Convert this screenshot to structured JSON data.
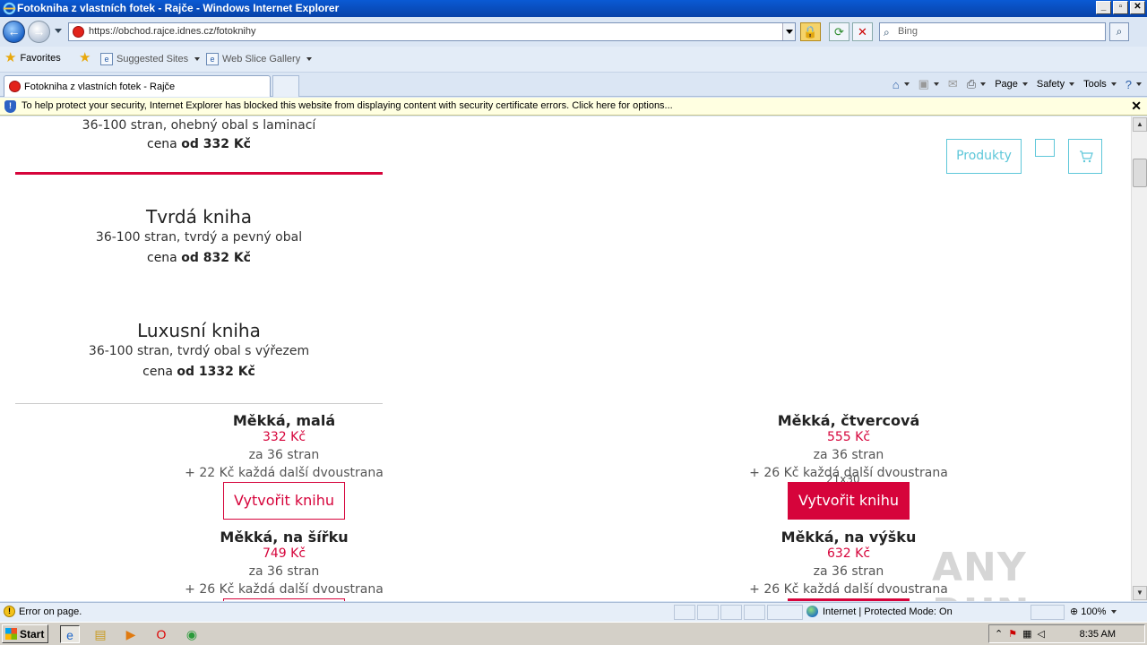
{
  "window": {
    "title": "Fotokniha z vlastních fotek - Rajče - Windows Internet Explorer",
    "min_label": "_",
    "max_label": "▫",
    "close_label": "✕"
  },
  "addressbar": {
    "back_icon": "back-arrow-icon",
    "forward_icon": "forward-arrow-icon",
    "url": "https://obchod.rajce.idnes.cz/fotoknihy",
    "search_placeholder": "Bing"
  },
  "favorites": {
    "favorites_label": "Favorites",
    "suggested_sites": "Suggested Sites",
    "web_slice_gallery": "Web Slice Gallery"
  },
  "tab": {
    "label": "Fotokniha z vlastních fotek - Rajče"
  },
  "commandbar": {
    "page": "Page",
    "safety": "Safety",
    "tools": "Tools"
  },
  "infobar": {
    "message": "To help protect your security, Internet Explorer has blocked this website from displaying content with security certificate errors. Click here for options..."
  },
  "page": {
    "top_product": {
      "desc": "36-100 stran, ohebný obal s laminací",
      "price_prefix": "cena",
      "price": "od 332 Kč"
    },
    "products": [
      {
        "name": "Tvrdá kniha",
        "desc": "36-100 stran, tvrdý a pevný obal",
        "price_prefix": "cena",
        "price": "od 832 Kč"
      },
      {
        "name": "Luxusní kniha",
        "desc": "36-100 stran, tvrdý obal s výřezem",
        "price_prefix": "cena",
        "price": "od 1332 Kč"
      }
    ],
    "header": {
      "produkty_label": "Produkty"
    },
    "tiles": [
      {
        "name": "Měkká, malá",
        "price": "332 Kč",
        "pages": "za 36 stran",
        "extra": "+ 22 Kč každá další dvoustrana",
        "button": "Vytvořit knihu"
      },
      {
        "name": "Měkká, čtvercová",
        "price": "555 Kč",
        "pages": "za 36 stran",
        "extra": "+ 26 Kč každá další dvoustrana",
        "button": "Vytvořit knihu",
        "overlap_text": "21x30"
      },
      {
        "name": "Měkká, na šířku",
        "price": "749 Kč",
        "pages": "za 36 stran",
        "extra": "+ 26 Kč každá další dvoustrana"
      },
      {
        "name": "Měkká, na výšku",
        "price": "632 Kč",
        "pages": "za 36 stran",
        "extra": "+ 26 Kč každá další dvoustrana"
      }
    ],
    "accent_color": "#d6043b",
    "secondary_color": "#5ec7d9"
  },
  "watermark": "ANY RUN",
  "statusbar": {
    "error": "Error on page.",
    "zone": "Internet | Protected Mode: On",
    "zoom": "100%"
  },
  "taskbar": {
    "start": "Start",
    "clock": "8:35 AM"
  }
}
